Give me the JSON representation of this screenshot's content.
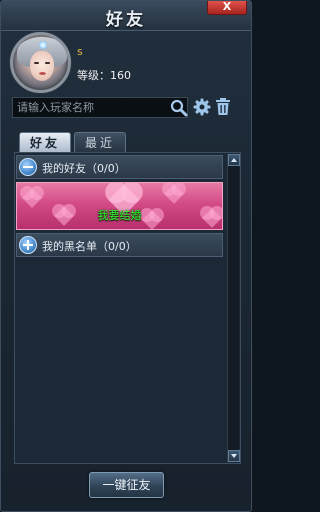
{
  "window": {
    "title": "好友",
    "close_label": "X"
  },
  "player": {
    "name": "s",
    "level": "等级：160"
  },
  "search": {
    "placeholder": "请输入玩家名称"
  },
  "tabs": [
    {
      "label": "好友",
      "active": true
    },
    {
      "label": "最近",
      "active": false
    }
  ],
  "groups": {
    "friends": {
      "label": "我的好友（0/0）",
      "expanded": true
    },
    "blacklist": {
      "label": "我的黑名单（0/0）",
      "expanded": false
    }
  },
  "banner": {
    "label": "我要结婚"
  },
  "footer": {
    "button_label": "一键征友"
  },
  "colors": {
    "name": "#e8b64c",
    "banner_text": "#2cf52c",
    "banner_bg": "#d24a86"
  },
  "icons": [
    "search-icon",
    "gear-icon",
    "trash-icon",
    "minus-icon",
    "plus-icon",
    "close-icon"
  ]
}
